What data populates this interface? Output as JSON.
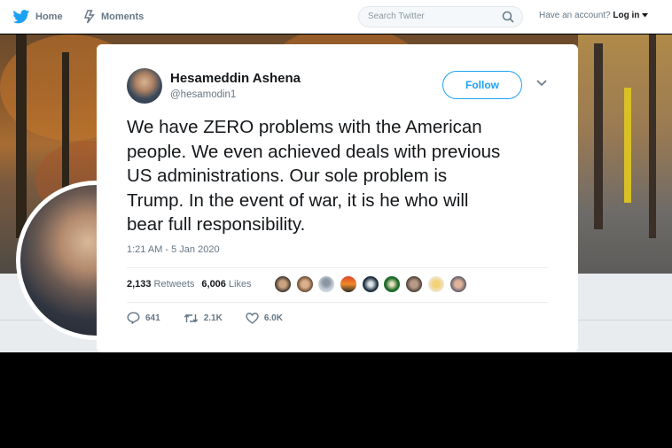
{
  "nav": {
    "home_label": "Home",
    "moments_label": "Moments",
    "search_placeholder": "Search Twitter",
    "account_prompt": "Have an account?",
    "login_label": "Log in"
  },
  "tweet": {
    "author_name": "Hesameddin Ashena",
    "author_handle": "@hesamodin1",
    "follow_label": "Follow",
    "text": "We have ZERO problems with the American\npeople. We even achieved deals with previous\nUS administrations.  Our sole problem is\nTrump. In the event of war, it is he who will\nbear full responsibility.",
    "timestamp": "1:21 AM - 5 Jan 2020",
    "retweets_count": "2,133",
    "retweets_label": "Retweets",
    "likes_count": "6,006",
    "likes_label": "Likes",
    "replies": "641",
    "retweets_short": "2.1K",
    "likes_short": "6.0K"
  },
  "icons": [
    "twitter-bird-icon",
    "moments-bolt-icon",
    "search-icon",
    "caret-down-icon",
    "chevron-down-icon",
    "reply-icon",
    "retweet-icon",
    "like-heart-icon"
  ],
  "colors": {
    "accent": "#1da1f2",
    "text": "#14171a",
    "muted": "#657786"
  }
}
